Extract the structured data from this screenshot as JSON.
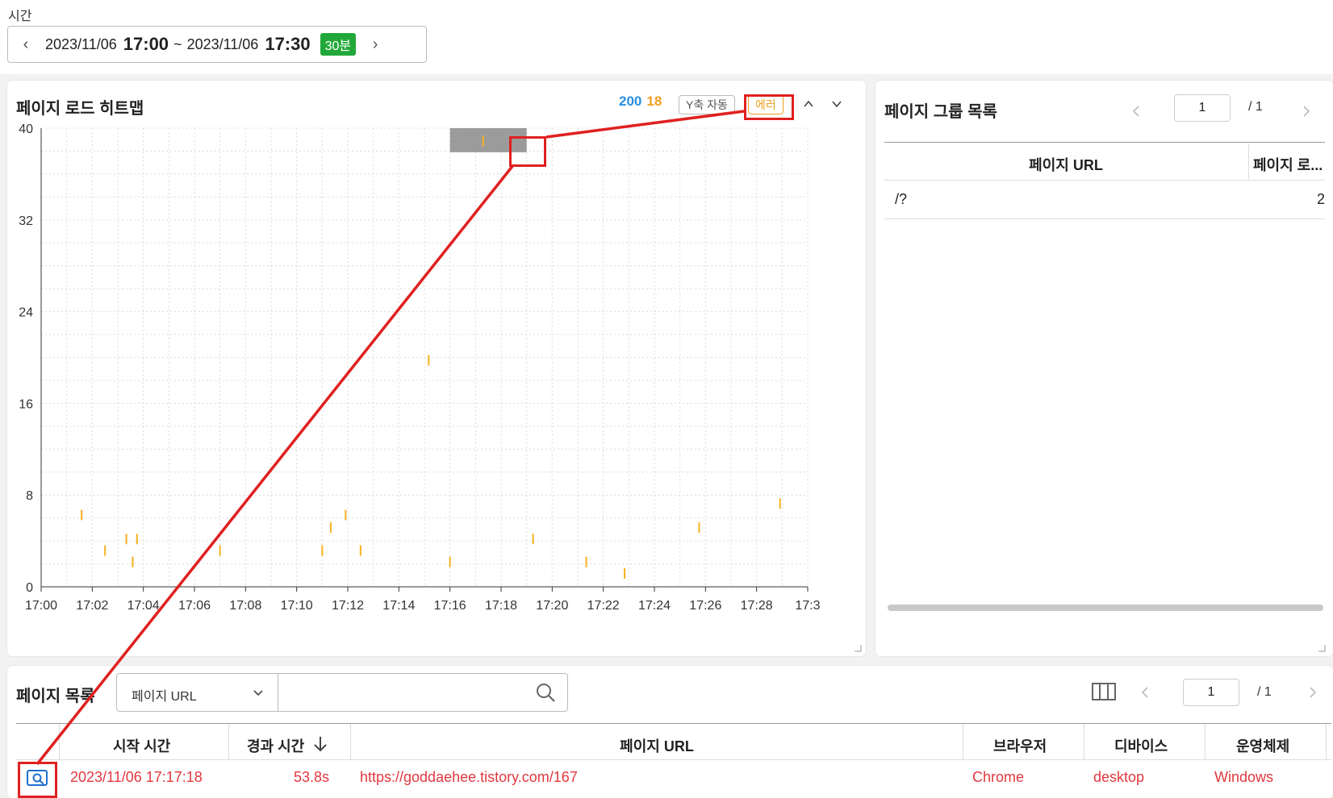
{
  "time": {
    "label": "시간",
    "start_date": "2023/11/06",
    "start_time": "17:00",
    "sep": "~",
    "end_date": "2023/11/06",
    "end_time": "17:30",
    "range_badge": "30분"
  },
  "heatmap": {
    "title": "페이지 로드 히트맵",
    "legend_ok": "200",
    "legend_err": "18",
    "yaxis_button": "Y축 자동",
    "error_button": "에러",
    "up_icon": "chevron-up-icon",
    "down_icon": "chevron-down-icon"
  },
  "chart_data": {
    "type": "scatter",
    "title": "페이지 로드 히트맵",
    "xlabel": "",
    "ylabel": "",
    "x_tick_labels": [
      "17:00",
      "17:02",
      "17:04",
      "17:06",
      "17:08",
      "17:10",
      "17:12",
      "17:14",
      "17:16",
      "17:18",
      "17:20",
      "17:22",
      "17:24",
      "17:26",
      "17:28",
      "17:3"
    ],
    "y_tick_labels": [
      "0",
      "8",
      "16",
      "24",
      "32",
      "40"
    ],
    "xlim": [
      "17:00",
      "17:30"
    ],
    "ylim": [
      0,
      40
    ],
    "grid": true,
    "error_color": "#f5b21e",
    "selection": {
      "x_start": "17:16",
      "x_end": "17:19",
      "y_low": 37.9,
      "y_high": 40
    },
    "series": [
      {
        "color": "#f5b21e",
        "points": [
          {
            "x": "17:01:35",
            "y": 6.3
          },
          {
            "x": "17:02:30",
            "y": 3.2
          },
          {
            "x": "17:03:20",
            "y": 4.2
          },
          {
            "x": "17:03:35",
            "y": 2.2
          },
          {
            "x": "17:03:45",
            "y": 4.2
          },
          {
            "x": "17:07:00",
            "y": 3.2
          },
          {
            "x": "17:11:00",
            "y": 3.2
          },
          {
            "x": "17:11:20",
            "y": 5.2
          },
          {
            "x": "17:11:55",
            "y": 6.3
          },
          {
            "x": "17:12:30",
            "y": 3.2
          },
          {
            "x": "17:15:10",
            "y": 19.8
          },
          {
            "x": "17:16:00",
            "y": 2.2
          },
          {
            "x": "17:17:18",
            "y": 38.9
          },
          {
            "x": "17:19:15",
            "y": 4.2
          },
          {
            "x": "17:21:20",
            "y": 2.2
          },
          {
            "x": "17:22:50",
            "y": 1.2
          },
          {
            "x": "17:25:45",
            "y": 5.2
          },
          {
            "x": "17:28:55",
            "y": 7.3
          }
        ]
      }
    ]
  },
  "page_group": {
    "title": "페이지 그룹 목록",
    "page_current": "1",
    "page_total": "/  1",
    "columns": [
      "페이지 URL",
      "페이지 로..."
    ],
    "rows": [
      {
        "url": "/?",
        "count": "2"
      }
    ]
  },
  "page_list": {
    "title": "페이지 목록",
    "filter_select": "페이지 URL",
    "search_value": "",
    "page_current": "1",
    "page_total": "/  1",
    "columns": {
      "start_time": "시작 시간",
      "elapsed": "경과 시간",
      "sort_icon": "arrow-down-icon",
      "url": "페이지 URL",
      "browser": "브라우저",
      "device": "디바이스",
      "os": "운영체제"
    },
    "rows": [
      {
        "start_time": "2023/11/06 17:17:18",
        "elapsed": "53.8s",
        "url": "https://goddaehee.tistory.com/167",
        "browser": "Chrome",
        "device": "desktop",
        "os": "Windows",
        "row_color": "#e0383e"
      }
    ]
  },
  "annotation_color": "#e02020"
}
